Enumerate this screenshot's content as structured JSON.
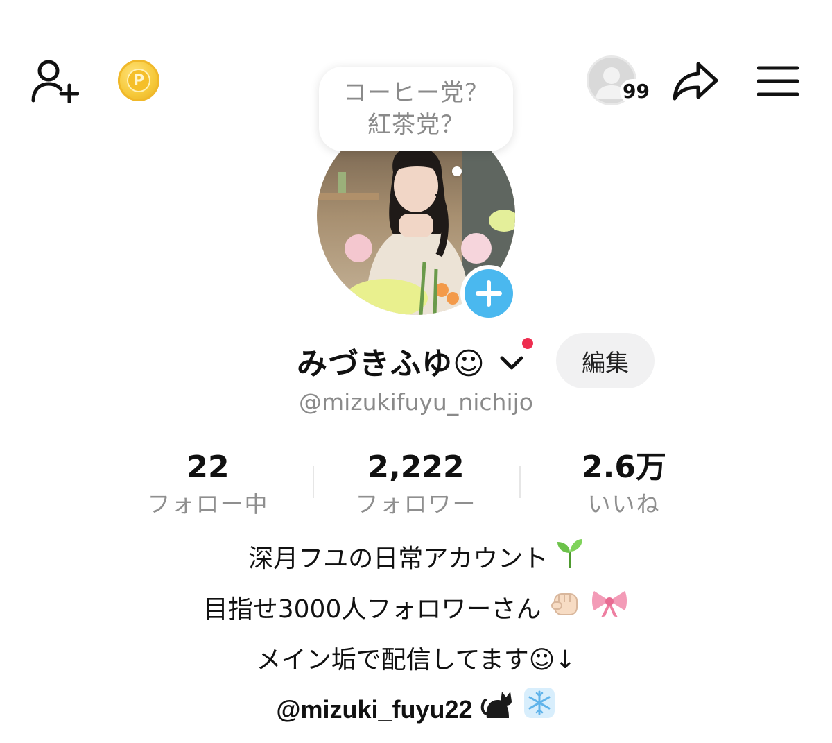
{
  "topbar": {
    "add_friend_icon": "person-plus-icon",
    "coin_icon": "coin-icon",
    "coin_letter": "P",
    "visitor_count": "99",
    "share_icon": "share-arrow-icon",
    "menu_icon": "hamburger-menu-icon"
  },
  "status_bubble": {
    "line1": "コーヒー党？",
    "line2": "紅茶党？"
  },
  "profile": {
    "name": "みづきふゆ☺",
    "handle": "@mizukifuyu_nichijo",
    "edit_label": "編集",
    "notify_color": "#ee2d4f",
    "add_button_color": "#4ab8ef"
  },
  "stats": [
    {
      "value": "22",
      "label": "フォロー中"
    },
    {
      "value": "2,222",
      "label": "フォロワー"
    },
    {
      "value": "2.6万",
      "label": "いいね"
    }
  ],
  "bio": {
    "line1": "深月フユの日常アカウント",
    "line2": "目指せ3000人フォロワーさん",
    "line3": "メイン垢で配信してます☺↓",
    "line4": "@mizuki_fuyu22"
  }
}
